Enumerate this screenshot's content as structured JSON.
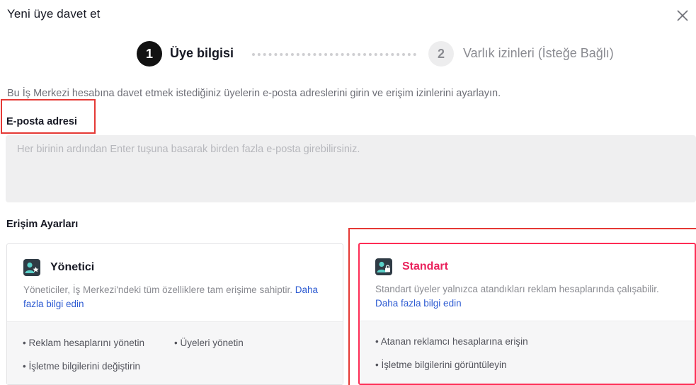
{
  "dialog": {
    "title": "Yeni üye davet et",
    "close_icon": "close-icon"
  },
  "stepper": {
    "steps": [
      {
        "number": "1",
        "label": "Üye bilgisi",
        "active": true
      },
      {
        "number": "2",
        "label": "Varlık izinleri (İsteğe Bağlı)",
        "active": false
      }
    ]
  },
  "intro_text": "Bu İş Merkezi hesabına davet etmek istediğiniz üyelerin e-posta adreslerini girin ve erişim izinlerini ayarlayın.",
  "email": {
    "label": "E-posta adresi",
    "value": "",
    "placeholder": "Her birinin ardından Enter tuşuna basarak birden fazla e-posta girebilirsiniz."
  },
  "access": {
    "title": "Erişim Ayarları",
    "roles": [
      {
        "name": "Yönetici",
        "icon": "admin-user-star-icon",
        "description": "Yöneticiler, İş Merkezi'ndeki tüm özelliklere tam erişime sahiptir.",
        "link": "Daha fazla bilgi edin",
        "features": [
          "• Reklam hesaplarını yönetin",
          "• Üyeleri yönetin",
          "• İşletme bilgilerini değiştirin"
        ],
        "selected": false
      },
      {
        "name": "Standart",
        "icon": "standard-user-lock-icon",
        "description": "Standart üyeler yalnızca atandıkları reklam hesaplarında çalışabilir.",
        "link": "Daha fazla bilgi edin",
        "features": [
          "• Atanan reklamcı hesaplarına erişin",
          "• İşletme bilgilerini görüntüleyin"
        ],
        "selected": true
      }
    ]
  },
  "colors": {
    "accent": "#fe2c55",
    "standard_title": "#e9225c",
    "link": "#2d5bd2",
    "highlight": "#e53935",
    "input_bg": "#efeff0"
  }
}
